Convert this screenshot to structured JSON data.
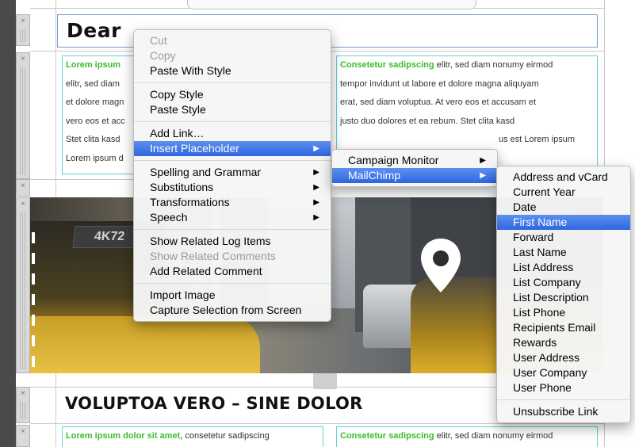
{
  "email": {
    "salutation": "Dear",
    "col1_lines": [
      "Lorem ipsum",
      "elitr, sed diam",
      "et dolore magn",
      "vero eos et acc",
      "Stet clita kasd",
      "Lorem ipsum d"
    ],
    "col2": {
      "lead": "Consetetur sadipscing",
      "first_rest": " elitr, sed diam nonumy eirmod",
      "lines": [
        "tempor invidunt ut labore et dolore magna aliquyam",
        "erat, sed diam voluptua. At vero eos et accusam et",
        "justo duo dolores et ea rebum. Stet clita kasd"
      ],
      "tail_line": "us est Lorem ipsum"
    },
    "taxi_sign": "4K72",
    "section_title": "VOLUPTOA VERO – SINE DOLOR",
    "bottom_col1": {
      "lead": "Lorem ipsum dolor sit amet,",
      "rest": " consetetur sadipscing"
    },
    "bottom_col2": {
      "lead": "Consetetur sadipscing",
      "rest": " elitr, sed diam nonumy eirmod"
    },
    "handle_close_glyph": "×"
  },
  "context_menu": {
    "groups": [
      [
        {
          "label": "Cut",
          "disabled": true
        },
        {
          "label": "Copy",
          "disabled": true
        },
        {
          "label": "Paste With Style"
        }
      ],
      [
        {
          "label": "Copy Style"
        },
        {
          "label": "Paste Style"
        }
      ],
      [
        {
          "label": "Add Link…"
        },
        {
          "label": "Insert Placeholder",
          "highlighted": true,
          "submenu": true
        }
      ],
      [
        {
          "label": "Spelling and Grammar",
          "submenu": true
        },
        {
          "label": "Substitutions",
          "submenu": true
        },
        {
          "label": "Transformations",
          "submenu": true
        },
        {
          "label": "Speech",
          "submenu": true
        }
      ],
      [
        {
          "label": "Show Related Log Items"
        },
        {
          "label": "Show Related Comments",
          "disabled": true
        },
        {
          "label": "Add Related Comment"
        }
      ],
      [
        {
          "label": "Import Image"
        },
        {
          "label": "Capture Selection from Screen"
        }
      ]
    ],
    "arrow_glyph": "▶"
  },
  "placeholder_menu": {
    "items": [
      {
        "label": "Campaign Monitor",
        "submenu": true
      },
      {
        "label": "MailChimp",
        "highlighted": true,
        "submenu": true
      }
    ]
  },
  "mailchimp_menu": {
    "items": [
      "Address and vCard",
      "Current Year",
      "Date",
      "First Name",
      "Forward",
      "Last Name",
      "List Address",
      "List Company",
      "List Description",
      "List Phone",
      "Recipients Email",
      "Rewards",
      "User Address",
      "User Company",
      "User Phone"
    ],
    "highlighted": "First Name",
    "footer_item": "Unsubscribe Link"
  },
  "colors": {
    "highlight": "#2e66e0",
    "column_border": "#5fd0d6",
    "lead_green": "#3dbb2c"
  },
  "icons": [
    "close-icon",
    "map-pin-icon",
    "image-placeholder-icon",
    "submenu-arrow-icon"
  ]
}
